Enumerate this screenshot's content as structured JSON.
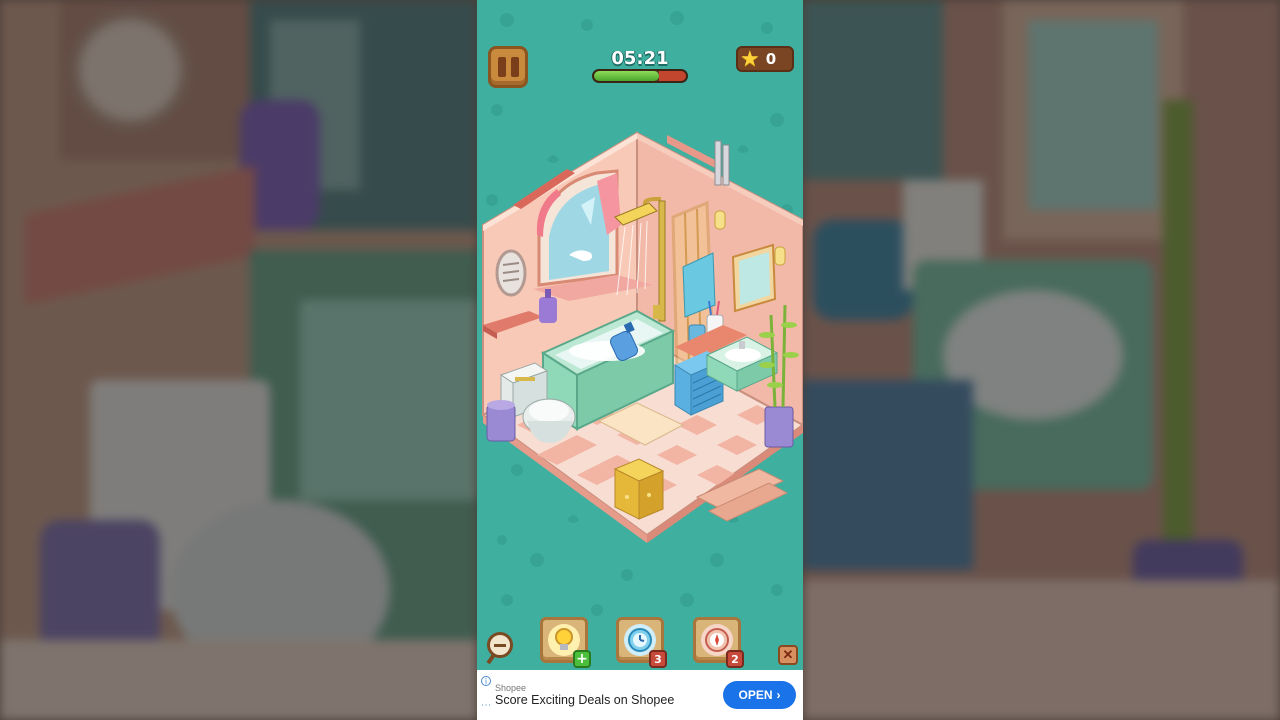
{
  "hud": {
    "timer": "05:21",
    "time_progress": 0.71,
    "stars": "0"
  },
  "toolbar": {
    "hint_badge": "+",
    "freeze_badge": "3",
    "compass_badge": "2"
  },
  "ad": {
    "brand": "Shopee",
    "title": "Score Exciting Deals on Shopee",
    "button": "OPEN"
  },
  "colors": {
    "background": "#3fb0a0",
    "wall": "#f6c7b6",
    "tub": "#8fd8b8",
    "floor_light": "#fbe6dc",
    "floor_dark": "#f3b8a8",
    "accent_wood": "#c98a3e"
  }
}
